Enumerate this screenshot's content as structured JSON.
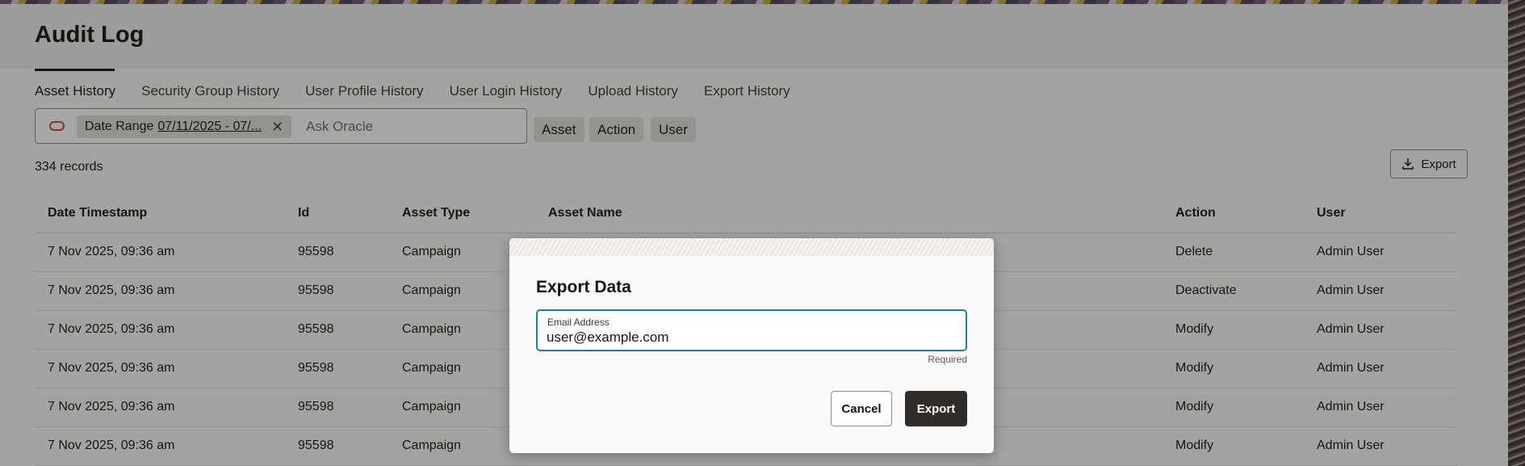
{
  "header": {
    "title": "Audit Log"
  },
  "tabs": [
    {
      "label": "Asset History",
      "active": true
    },
    {
      "label": "Security Group History"
    },
    {
      "label": "User Profile History"
    },
    {
      "label": "User Login History"
    },
    {
      "label": "Upload History"
    },
    {
      "label": "Export History"
    }
  ],
  "filter": {
    "chip_label": "Date Range",
    "chip_value": "07/11/2025 - 07/...",
    "search_placeholder": "Ask Oracle",
    "facets": [
      "Asset",
      "Action",
      "User"
    ]
  },
  "records_text": "334 records",
  "export_button_label": "Export",
  "table": {
    "headers": [
      "Date Timestamp",
      "Id",
      "Asset Type",
      "Asset Name",
      "Action",
      "User"
    ],
    "rows": [
      {
        "date": "7 Nov 2025, 09:36 am",
        "id": "95598",
        "type": "Campaign",
        "name": "",
        "action": "Delete",
        "user": "Admin User"
      },
      {
        "date": "7 Nov 2025, 09:36 am",
        "id": "95598",
        "type": "Campaign",
        "name": "",
        "action": "Deactivate",
        "user": "Admin User"
      },
      {
        "date": "7 Nov 2025, 09:36 am",
        "id": "95598",
        "type": "Campaign",
        "name": "",
        "action": "Modify",
        "user": "Admin User"
      },
      {
        "date": "7 Nov 2025, 09:36 am",
        "id": "95598",
        "type": "Campaign",
        "name": "",
        "action": "Modify",
        "user": "Admin User"
      },
      {
        "date": "7 Nov 2025, 09:36 am",
        "id": "95598",
        "type": "Campaign",
        "name": "",
        "action": "Modify",
        "user": "Admin User"
      },
      {
        "date": "7 Nov 2025, 09:36 am",
        "id": "95598",
        "type": "Campaign",
        "name": "",
        "action": "Modify",
        "user": "Admin User"
      }
    ]
  },
  "dialog": {
    "title": "Export Data",
    "email_label": "Email Address",
    "email_value": "user@example.com",
    "required_text": "Required",
    "cancel_label": "Cancel",
    "export_label": "Export"
  },
  "colors": {
    "brand_red": "#c74634",
    "focus_teal": "#227e9e",
    "primary_button": "#312d2a"
  }
}
